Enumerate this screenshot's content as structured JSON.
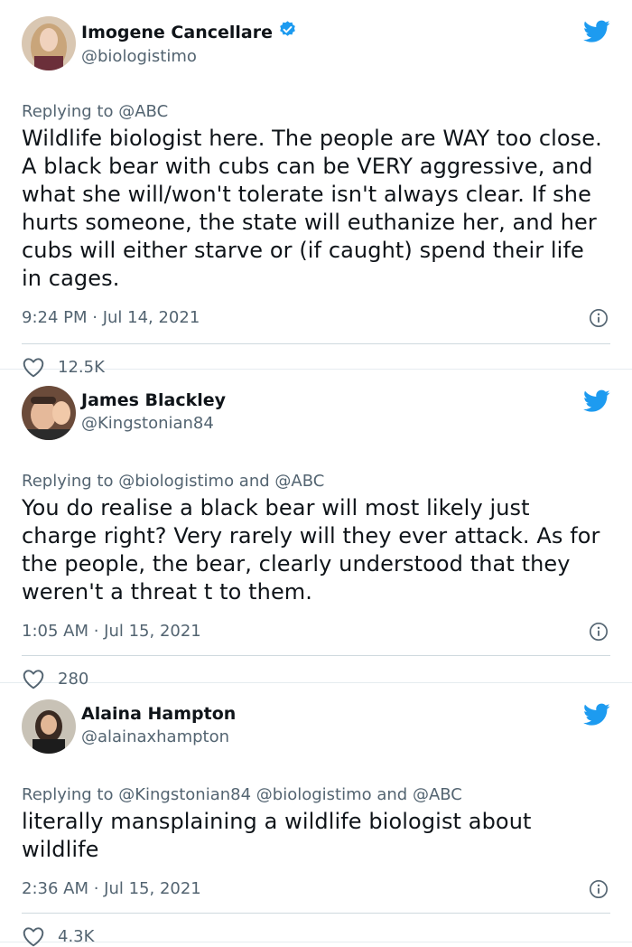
{
  "tweets": [
    {
      "name": "Imogene Cancellare",
      "verified": true,
      "handle": "@biologistimo",
      "reply_prefix": "Replying to",
      "reply_to": "@ABC",
      "text": "Wildlife biologist here. The people are WAY too close. A black bear with cubs can be VERY aggressive, and what she will/won't tolerate isn't always clear. If she hurts someone, the state will euthanize her, and her cubs will either starve or (if caught) spend their life in cages.",
      "timestamp": "9:24 PM · Jul 14, 2021",
      "likes": "12.5K"
    },
    {
      "name": "James Blackley",
      "verified": false,
      "handle": "@Kingstonian84",
      "reply_prefix": "Replying to",
      "reply_to": "@biologistimo and @ABC",
      "text": "You do realise a black bear will most likely just charge right? Very rarely will they ever attack. As for the people, the bear, clearly understood that they weren't a threat t to them.",
      "timestamp": "1:05 AM · Jul 15, 2021",
      "likes": "280"
    },
    {
      "name": "Alaina Hampton",
      "verified": false,
      "handle": "@alainaxhampton",
      "reply_prefix": "Replying to",
      "reply_to": "@Kingstonian84 @biologistimo and @ABC",
      "text": "literally mansplaining a wildlife biologist about wildlife",
      "timestamp": "2:36 AM · Jul 15, 2021",
      "likes": "4.3K"
    }
  ],
  "colors": {
    "twitter_blue": "#1d9bf0",
    "secondary_text": "#536471",
    "primary_text": "#0f1419"
  }
}
